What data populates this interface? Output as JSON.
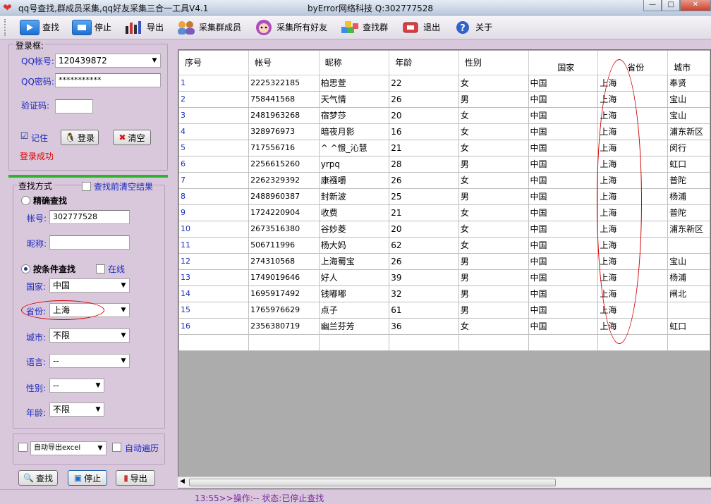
{
  "window": {
    "title": "qq号查找,群成员采集,qq好友采集三合一工具V4.1",
    "author": "byError网络科技 Q:302777528",
    "min": "—",
    "max": "□",
    "close": "✕"
  },
  "toolbar": [
    {
      "id": "find",
      "label": "查找",
      "icon": "play-icon"
    },
    {
      "id": "stop",
      "label": "停止",
      "icon": "stop-icon"
    },
    {
      "id": "export",
      "label": "导出",
      "icon": "bar-chart-icon"
    },
    {
      "id": "group",
      "label": "采集群成员",
      "icon": "users-icon"
    },
    {
      "id": "friends",
      "label": "采集所有好友",
      "icon": "avatar-icon"
    },
    {
      "id": "findgroup",
      "label": "查找群",
      "icon": "cubes-icon"
    },
    {
      "id": "exit",
      "label": "退出",
      "icon": "exit-icon"
    },
    {
      "id": "about",
      "label": "关于",
      "icon": "help-icon"
    }
  ],
  "login": {
    "group_label": "登录框:",
    "qq_label": "QQ帐号:",
    "qq_value": "120439872",
    "pwd_label": "QQ密码:",
    "pwd_value": "***********",
    "code_label": "验证码:",
    "code_value": "",
    "remember_label": "记住",
    "remember_checked": "☑",
    "login_button": "登录",
    "clear_button": "清空",
    "status": "登录成功"
  },
  "search": {
    "group_label": "查找方式",
    "clear_before_label": "查找前清空结果",
    "exact_label": "精确查找",
    "account_label": "帐号:",
    "account_value": "302777528",
    "nickname_label": "昵称:",
    "nickname_value": "",
    "cond_label": "按条件查找",
    "online_label": "在线",
    "country_label": "国家:",
    "country_value": "中国",
    "province_label": "省份:",
    "province_value": "上海",
    "city_label": "城市:",
    "city_value": "不限",
    "language_label": "语言:",
    "language_value": "--",
    "gender_label": "性别:",
    "gender_value": "--",
    "age_label": "年龄:",
    "age_value": "不限",
    "export_excel_value": "自动导出excel",
    "auto_traverse_label": "自动遍历",
    "find_button": "查找",
    "stop_button": "停止",
    "export_button": "导出"
  },
  "table": {
    "headers": [
      "序号",
      "帐号",
      "昵称",
      "年龄",
      "性别",
      "国家",
      "省份",
      "城市"
    ],
    "rows": [
      [
        "1",
        "2225322185",
        "柏思萱",
        "22",
        "女",
        "中国",
        "上海",
        "奉贤"
      ],
      [
        "2",
        "758441568",
        "天气情",
        "26",
        "男",
        "中国",
        "上海",
        "宝山"
      ],
      [
        "3",
        "2481963268",
        "宿梦莎",
        "20",
        "女",
        "中国",
        "上海",
        "宝山"
      ],
      [
        "4",
        "328976973",
        "暗夜月影",
        "16",
        "女",
        "中国",
        "上海",
        "浦东新区"
      ],
      [
        "5",
        "717556716",
        "^ ^憬_沁慧",
        "21",
        "女",
        "中国",
        "上海",
        "闵行"
      ],
      [
        "6",
        "2256615260",
        "yrpq",
        "28",
        "男",
        "中国",
        "上海",
        "虹口"
      ],
      [
        "7",
        "2262329392",
        "康襁嚼",
        "26",
        "女",
        "中国",
        "上海",
        "普陀"
      ],
      [
        "8",
        "2488960387",
        "封新波",
        "25",
        "男",
        "中国",
        "上海",
        "杨浦"
      ],
      [
        "9",
        "1724220904",
        "收费",
        "21",
        "女",
        "中国",
        "上海",
        "普陀"
      ],
      [
        "10",
        "2673516380",
        "谷妙菱",
        "20",
        "女",
        "中国",
        "上海",
        "浦东新区"
      ],
      [
        "11",
        "506711996",
        "杨大妈",
        "62",
        "女",
        "中国",
        "上海",
        ""
      ],
      [
        "12",
        "274310568",
        "上海蜀宝",
        "26",
        "男",
        "中国",
        "上海",
        "宝山"
      ],
      [
        "13",
        "1749019646",
        "好人",
        "39",
        "男",
        "中国",
        "上海",
        "杨浦"
      ],
      [
        "14",
        "1695917492",
        "钱嘟嘟",
        "32",
        "男",
        "中国",
        "上海",
        "闸北"
      ],
      [
        "15",
        "1765976629",
        "点子",
        "61",
        "男",
        "中国",
        "上海",
        ""
      ],
      [
        "16",
        "2356380719",
        "幽兰芬芳",
        "36",
        "女",
        "中国",
        "上海",
        "虹口"
      ]
    ]
  },
  "statusbar": {
    "text": "13:55>>操作:-- 状态:已停止查找"
  },
  "colors": {
    "panel": "#d9c7dc",
    "accent_green": "#2bb52b",
    "annotation_red": "#d10000",
    "label_blue": "#1a2cbf",
    "status_red": "#e00000"
  }
}
